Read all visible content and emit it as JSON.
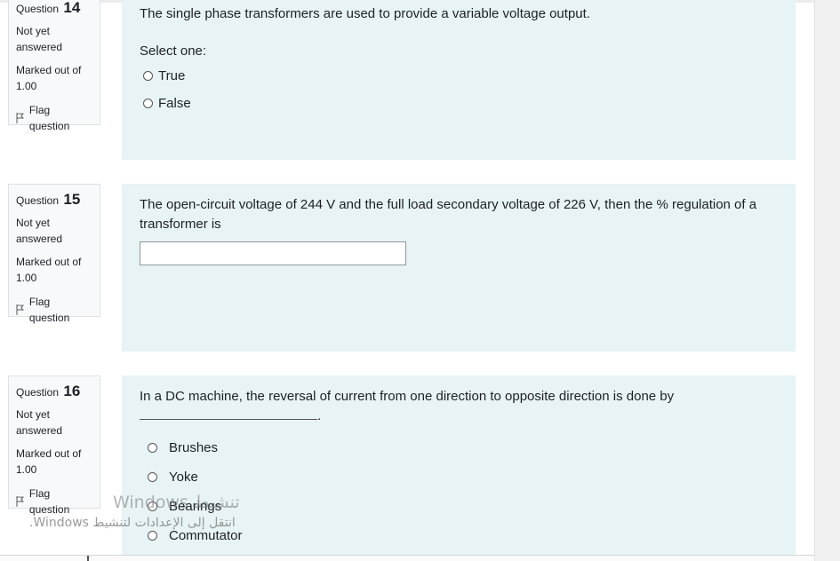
{
  "questions": [
    {
      "number_label": "Question",
      "number": "14",
      "state": "Not yet answered",
      "grade": "Marked out of 1.00",
      "flag_label": "Flag question",
      "text": "The single phase transformers are used to provide a variable voltage output.",
      "prompt": "Select one:",
      "options": [
        "True",
        "False"
      ]
    },
    {
      "number_label": "Question",
      "number": "15",
      "state": "Not yet answered",
      "grade": "Marked out of 1.00",
      "flag_label": "Flag question",
      "text": "The open-circuit voltage of 244 V and the full load secondary voltage of 226 V, then the % regulation of  a transformer is",
      "answer_value": ""
    },
    {
      "number_label": "Question",
      "number": "16",
      "state": "Not yet answered",
      "grade": "Marked out of 1.00",
      "flag_label": "Flag question",
      "text": "In a DC machine, the reversal of current from one direction to opposite direction is done by",
      "options": [
        "Brushes",
        "Yoke",
        "Bearings",
        "Commutator"
      ]
    }
  ],
  "watermark": {
    "line1": "تنشيط Windows",
    "line2": "انتقل إلى الإعدادات لتنشيط Windows."
  }
}
